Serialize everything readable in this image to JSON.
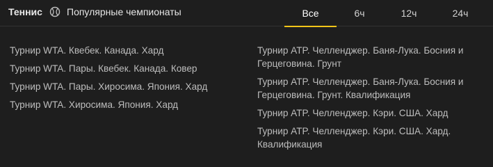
{
  "header": {
    "sport": "Теннис",
    "section": "Популярные чемпионаты",
    "icon": "tennis-ball-icon",
    "tabs": [
      {
        "label": "Все",
        "active": true
      },
      {
        "label": "6ч",
        "active": false
      },
      {
        "label": "12ч",
        "active": false
      },
      {
        "label": "24ч",
        "active": false
      }
    ],
    "accent_color": "#f5c518"
  },
  "tournaments_left": [
    "Турнир WTA. Квебек. Канада. Хард",
    "Турнир WTA. Пары. Квебек. Канада. Ковер",
    "Турнир WTA. Пары. Хиросима. Япония. Хард",
    "Турнир WTA. Хиросима. Япония. Хард"
  ],
  "tournaments_right": [
    "Турнир ATP. Челленджер. Баня-Лука. Босния и Герцеговина. Грунт",
    "Турнир ATP. Челленджер. Баня-Лука. Босния и Герцеговина. Грунт. Квалификация",
    "Турнир ATP. Челленджер. Кэри. США. Хард",
    "Турнир ATP. Челленджер. Кэри. США. Хард. Квалификация"
  ]
}
